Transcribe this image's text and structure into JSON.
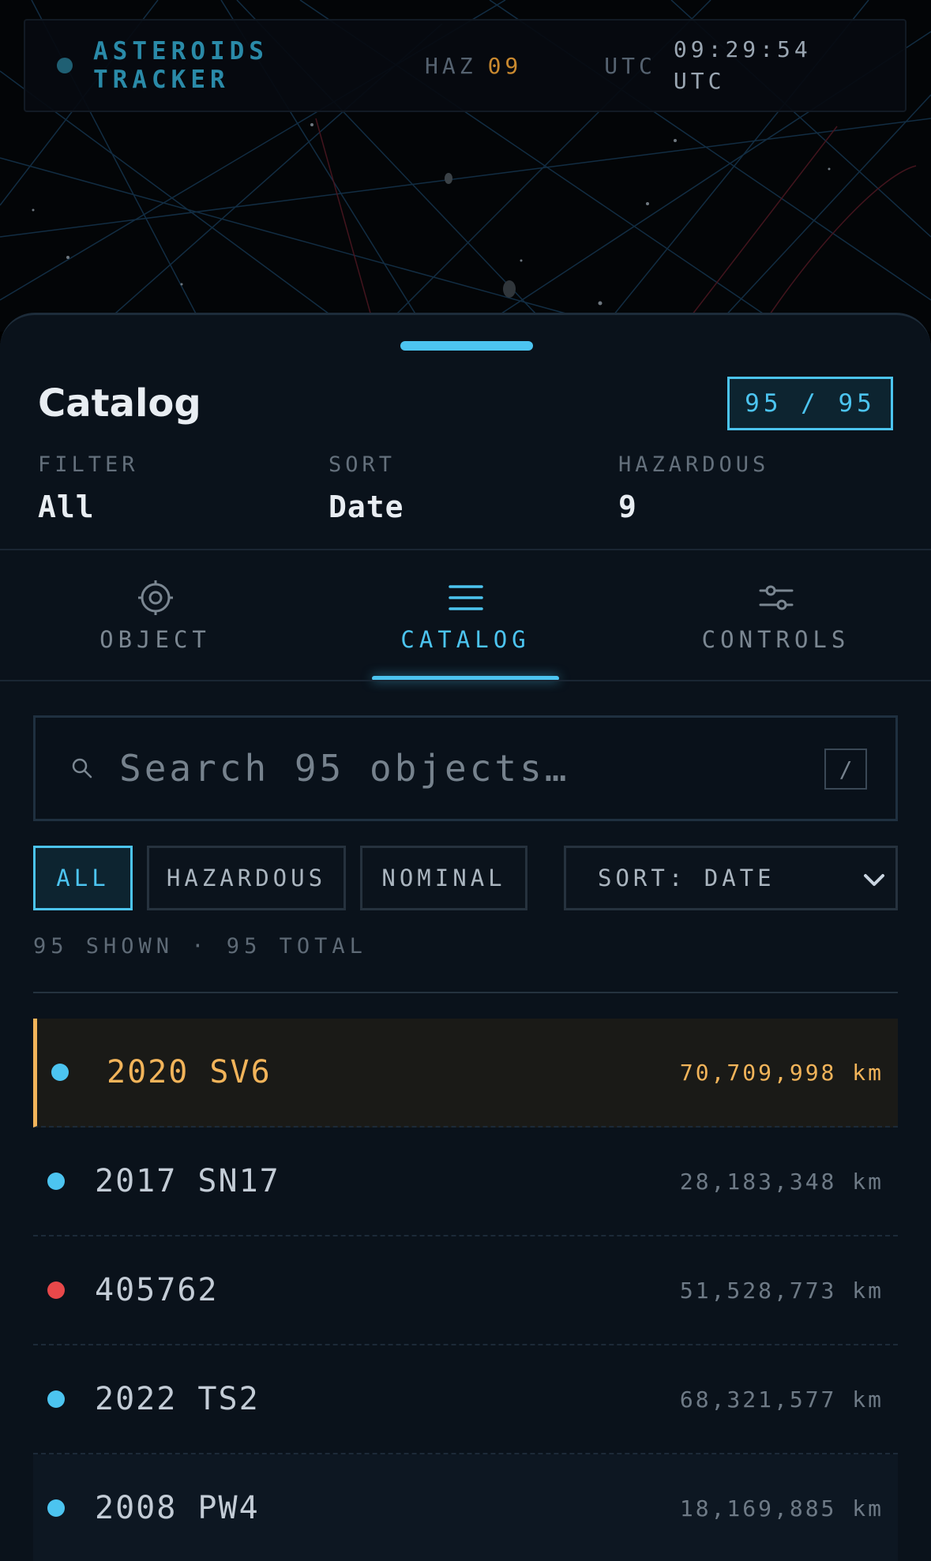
{
  "topbar": {
    "brand": "ASTEROIDS TRACKER",
    "haz_label": "HAZ",
    "haz_value": "09",
    "utc_label": "UTC",
    "utc_time": "09:29:54 UTC"
  },
  "sheet": {
    "title": "Catalog",
    "count_badge": "95 / 95",
    "stats": [
      {
        "label": "FILTER",
        "value": "All"
      },
      {
        "label": "SORT",
        "value": "Date"
      },
      {
        "label": "HAZARDOUS",
        "value": "9"
      }
    ]
  },
  "tabs": [
    {
      "label": "OBJECT",
      "icon": "target-icon",
      "active": false
    },
    {
      "label": "CATALOG",
      "icon": "list-icon",
      "active": true
    },
    {
      "label": "CONTROLS",
      "icon": "sliders-icon",
      "active": false
    }
  ],
  "search": {
    "placeholder": "Search 95 objects…",
    "shortcut": "/"
  },
  "filters": {
    "chips": [
      "ALL",
      "HAZARDOUS",
      "NOMINAL"
    ],
    "active": "ALL",
    "sort_label": "SORT: DATE"
  },
  "summary": "95 SHOWN · 95 TOTAL",
  "objects": [
    {
      "name": "2020 SV6",
      "distance": "70,709,998 km",
      "hazardous": false,
      "selected": true
    },
    {
      "name": "2017 SN17",
      "distance": "28,183,348 km",
      "hazardous": false,
      "selected": false
    },
    {
      "name": "405762",
      "distance": "51,528,773 km",
      "hazardous": true,
      "selected": false
    },
    {
      "name": "2022 TS2",
      "distance": "68,321,577 km",
      "hazardous": false,
      "selected": false
    },
    {
      "name": "2008 PW4",
      "distance": "18,169,885 km",
      "hazardous": false,
      "selected": false
    }
  ],
  "colors": {
    "accent": "#4cc4f0",
    "selected": "#f2b45a",
    "hazard": "#e8484a",
    "nominal": "#4cc4f0"
  }
}
